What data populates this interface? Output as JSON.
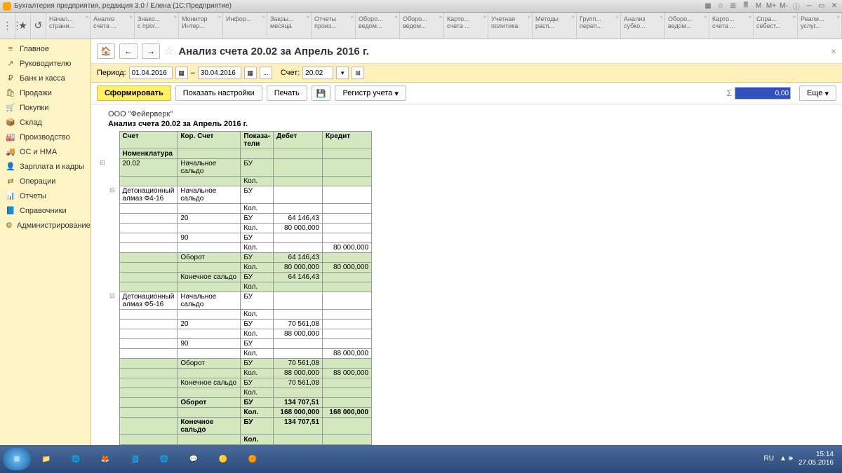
{
  "window": {
    "title": "Бухгалтерия предприятия, редакция 3.0 / Елена  (1С:Предприятие)"
  },
  "tabs": [
    {
      "l1": "Начал...",
      "l2": "страни..."
    },
    {
      "l1": "Анализ",
      "l2": "счета ..."
    },
    {
      "l1": "Знако...",
      "l2": "с прог..."
    },
    {
      "l1": "Монитор",
      "l2": "Интер..."
    },
    {
      "l1": "Инфор...",
      "l2": ""
    },
    {
      "l1": "Закры...",
      "l2": "месяца"
    },
    {
      "l1": "Отчеты",
      "l2": "произ..."
    },
    {
      "l1": "Оборо...",
      "l2": "ведом..."
    },
    {
      "l1": "Оборо...",
      "l2": "ведом..."
    },
    {
      "l1": "Карто...",
      "l2": "счета ..."
    },
    {
      "l1": "Учетная",
      "l2": "политика"
    },
    {
      "l1": "Методы",
      "l2": "расп..."
    },
    {
      "l1": "Групп...",
      "l2": "переп..."
    },
    {
      "l1": "Анализ",
      "l2": "субко..."
    },
    {
      "l1": "Оборо...",
      "l2": "ведом..."
    },
    {
      "l1": "Карто...",
      "l2": "счета ..."
    },
    {
      "l1": "Спра...",
      "l2": "себест..."
    },
    {
      "l1": "Реали...",
      "l2": "услуг..."
    }
  ],
  "sidebar": [
    {
      "icon": "≡",
      "label": "Главное"
    },
    {
      "icon": "↗",
      "label": "Руководителю"
    },
    {
      "icon": "₽",
      "label": "Банк и касса"
    },
    {
      "icon": "🛍",
      "label": "Продажи"
    },
    {
      "icon": "🛒",
      "label": "Покупки"
    },
    {
      "icon": "📦",
      "label": "Склад"
    },
    {
      "icon": "🏭",
      "label": "Производство"
    },
    {
      "icon": "🚚",
      "label": "ОС и НМА"
    },
    {
      "icon": "👤",
      "label": "Зарплата и кадры"
    },
    {
      "icon": "⇄",
      "label": "Операции"
    },
    {
      "icon": "📊",
      "label": "Отчеты"
    },
    {
      "icon": "📘",
      "label": "Справочники"
    },
    {
      "icon": "⚙",
      "label": "Администрирование"
    }
  ],
  "page": {
    "title": "Анализ счета 20.02 за Апрель 2016 г.",
    "period_label": "Период:",
    "date_from": "01.04.2016",
    "date_to": "30.04.2016",
    "account_label": "Счет:",
    "account": "20.02",
    "btn_form": "Сформировать",
    "btn_settings": "Показать настройки",
    "btn_print": "Печать",
    "btn_register": "Регистр учета",
    "btn_more": "Еще",
    "sum_value": "0,00"
  },
  "report": {
    "org": "ООО \"Фейерверк\"",
    "title": "Анализ счета 20.02 за Апрель 2016 г.",
    "headers": {
      "c1": "Счет",
      "c2": "Кор. Счет",
      "c3": "Показа-\nтели",
      "c4": "Дебет",
      "c5": "Кредит",
      "c1b": "Номенклатура"
    },
    "rows": [
      {
        "t": 0,
        "c1": "20.02",
        "c2": "Начальное сальдо",
        "c3": "БУ",
        "shade": true,
        "tree": "⊟"
      },
      {
        "t": 0,
        "c1": "",
        "c2": "",
        "c3": "Кол.",
        "shade": true
      },
      {
        "t": 1,
        "c1": "Детонационный алмаз Ф4-16",
        "c2": "Начальное сальдо",
        "c3": "БУ",
        "tree": "⊟"
      },
      {
        "t": 1,
        "c1": "",
        "c2": "",
        "c3": "Кол."
      },
      {
        "t": 1,
        "c1": "",
        "c2": "20",
        "c3": "БУ",
        "c4": "64 146,43"
      },
      {
        "t": 1,
        "c1": "",
        "c2": "",
        "c3": "Кол.",
        "c4": "80 000,000"
      },
      {
        "t": 1,
        "c1": "",
        "c2": "90",
        "c3": "БУ"
      },
      {
        "t": 1,
        "c1": "",
        "c2": "",
        "c3": "Кол.",
        "c5": "80 000,000"
      },
      {
        "t": 1,
        "c1": "",
        "c2": "Оборот",
        "c3": "БУ",
        "c4": "64 146,43",
        "shade": true
      },
      {
        "t": 1,
        "c1": "",
        "c2": "",
        "c3": "Кол.",
        "c4": "80 000,000",
        "c5": "80 000,000",
        "shade": true
      },
      {
        "t": 1,
        "c1": "",
        "c2": "Конечное сальдо",
        "c3": "БУ",
        "c4": "64 146,43",
        "shade": true
      },
      {
        "t": 1,
        "c1": "",
        "c2": "",
        "c3": "Кол.",
        "shade": true
      },
      {
        "t": 1,
        "c1": "Детонационный алмаз Ф5-16",
        "c2": "Начальное сальдо",
        "c3": "БУ",
        "tree": "⊟"
      },
      {
        "t": 1,
        "c1": "",
        "c2": "",
        "c3": "Кол."
      },
      {
        "t": 1,
        "c1": "",
        "c2": "20",
        "c3": "БУ",
        "c4": "70 561,08"
      },
      {
        "t": 1,
        "c1": "",
        "c2": "",
        "c3": "Кол.",
        "c4": "88 000,000"
      },
      {
        "t": 1,
        "c1": "",
        "c2": "90",
        "c3": "БУ"
      },
      {
        "t": 1,
        "c1": "",
        "c2": "",
        "c3": "Кол.",
        "c5": "88 000,000"
      },
      {
        "t": 1,
        "c1": "",
        "c2": "Оборот",
        "c3": "БУ",
        "c4": "70 561,08",
        "shade": true
      },
      {
        "t": 1,
        "c1": "",
        "c2": "",
        "c3": "Кол.",
        "c4": "88 000,000",
        "c5": "88 000,000",
        "shade": true
      },
      {
        "t": 1,
        "c1": "",
        "c2": "Конечное сальдо",
        "c3": "БУ",
        "c4": "70 561,08",
        "shade": true
      },
      {
        "t": 1,
        "c1": "",
        "c2": "",
        "c3": "Кол.",
        "shade": true
      },
      {
        "t": 0,
        "c1": "",
        "c2": "Оборот",
        "c3": "БУ",
        "c4": "134 707,51",
        "shade": true,
        "bold": true
      },
      {
        "t": 0,
        "c1": "",
        "c2": "",
        "c3": "Кол.",
        "c4": "168 000,000",
        "c5": "168 000,000",
        "shade": true,
        "bold": true
      },
      {
        "t": 0,
        "c1": "",
        "c2": "Конечное сальдо",
        "c3": "БУ",
        "c4": "134 707,51",
        "shade": true,
        "bold": true
      },
      {
        "t": 0,
        "c1": "",
        "c2": "",
        "c3": "Кол.",
        "shade": true,
        "bold": true
      }
    ]
  },
  "taskbar": {
    "lang": "RU",
    "time": "15:14",
    "date": "27.05.2016",
    "items": [
      "📁",
      "🌐",
      "🦊",
      "📘",
      "🌐",
      "💬",
      "🟡",
      "🟠"
    ]
  }
}
